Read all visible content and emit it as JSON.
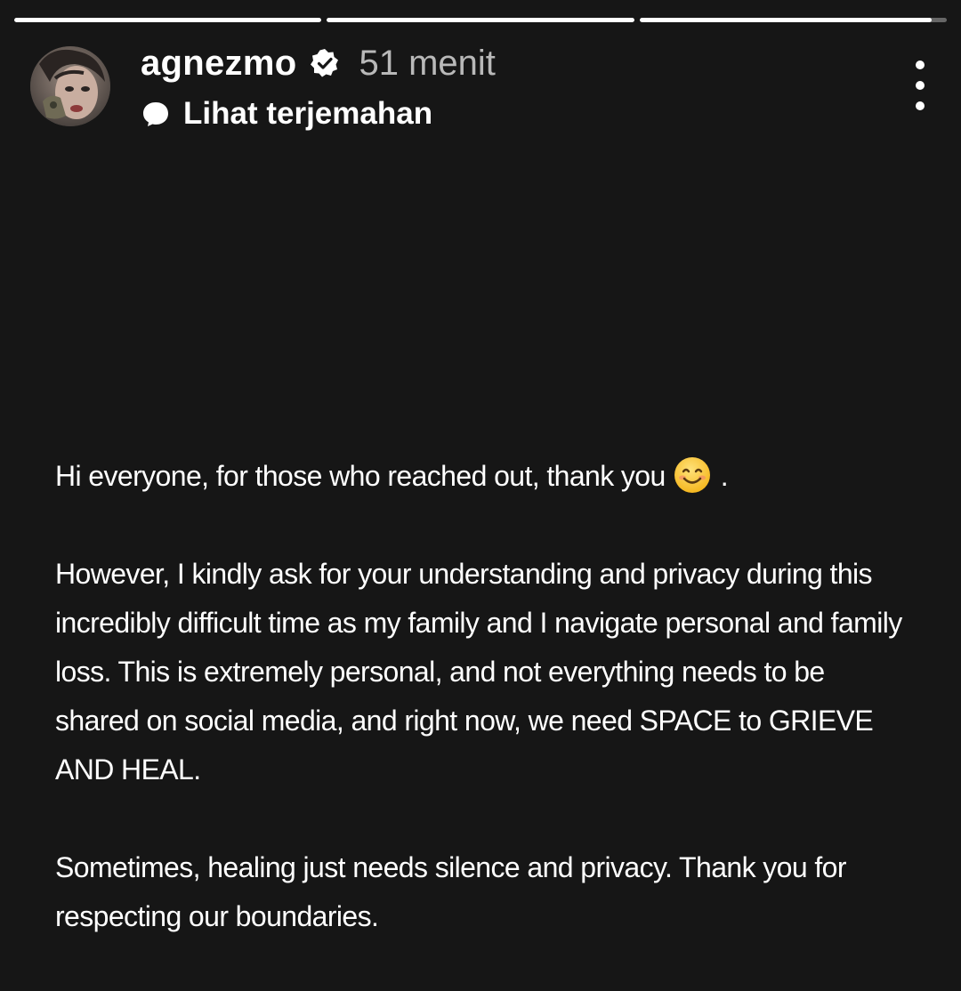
{
  "story": {
    "progress": [
      1,
      1,
      0.95
    ]
  },
  "header": {
    "username": "agnezmo",
    "verified_icon": "verified-badge-icon",
    "timestamp": "51 menit",
    "translate_label": "Lihat terjemahan",
    "translate_icon": "speech-bubble-icon",
    "more_icon": "more-vertical-icon"
  },
  "post": {
    "line1_text": "Hi everyone, for those who reached out, thank you",
    "line1_emoji": "smiling-face-emoji",
    "line1_end": ".",
    "para2": "However, I kindly ask for your understanding and privacy during this incredibly difficult time as my family and I navigate personal and family loss. This is extremely personal, and not everything needs to be shared on social media, and right now, we need SPACE to GRIEVE AND HEAL.",
    "para3": "Sometimes, healing just needs silence and privacy. Thank you for respecting our boundaries."
  },
  "colors": {
    "background": "#161616",
    "text": "#ffffff",
    "timestamp": "#b9b9b9"
  }
}
